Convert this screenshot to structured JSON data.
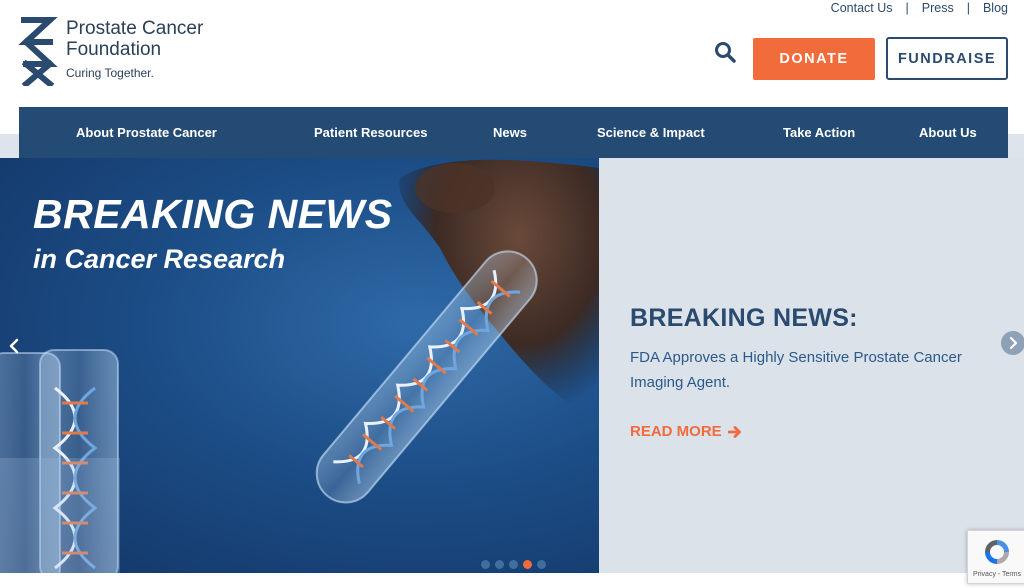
{
  "utility_links": [
    "Contact Us",
    "Press",
    "Blog"
  ],
  "logo": {
    "name_line1": "Prostate Cancer",
    "name_line2": "Foundation",
    "tagline": "Curing Together."
  },
  "header": {
    "search_icon": "search-icon",
    "donate_label": "DONATE",
    "fundraise_label": "FUNDRAISE"
  },
  "nav": {
    "items": [
      "About Prostate Cancer",
      "Patient Resources",
      "News",
      "Science & Impact",
      "Take Action",
      "About Us"
    ]
  },
  "hero": {
    "image_headline_1": "BREAKING NEWS",
    "image_headline_2": "in Cancer Research",
    "title": "BREAKING NEWS:",
    "description": "FDA Approves a Highly Sensitive Prostate Cancer Imaging Agent.",
    "read_more": "READ MORE",
    "slide_count": 5,
    "active_slide": 4
  },
  "recaptcha": {
    "text": "Privacy - Terms"
  },
  "colors": {
    "navy": "#234b74",
    "orange": "#f26c3b",
    "text_blue": "#2b4a6f",
    "panel": "#dbe2ea"
  }
}
